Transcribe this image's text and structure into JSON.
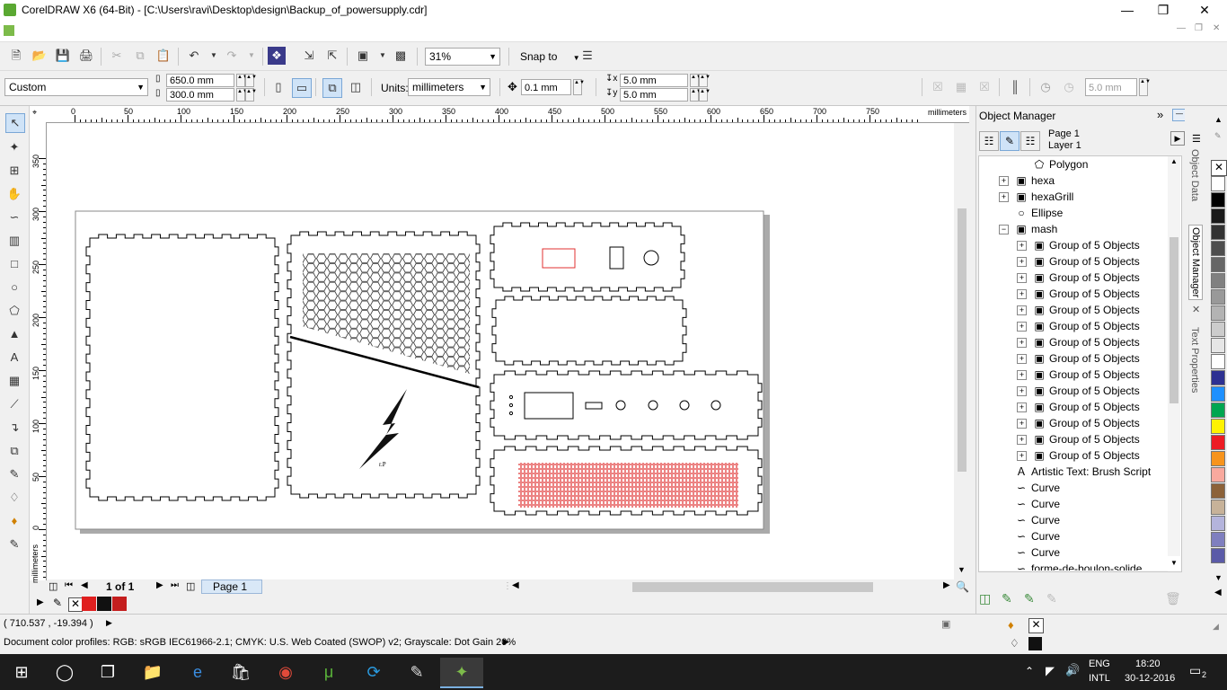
{
  "window": {
    "title": "CorelDRAW X6 (64-Bit) - [C:\\Users\\ravi\\Desktop\\design\\Backup_of_powersupply.cdr]"
  },
  "toolbar": {
    "zoom": "31%",
    "snap_to": "Snap to"
  },
  "property_bar": {
    "preset": "Custom",
    "width": "650.0 mm",
    "height": "300.0 mm",
    "units_label": "Units:",
    "units": "millimeters",
    "nudge": "0.1 mm",
    "dup_x": "5.0 mm",
    "dup_y": "5.0 mm",
    "bleed": "5.0 mm"
  },
  "ruler": {
    "h_ticks": [
      "0",
      "50",
      "100",
      "150",
      "200",
      "250",
      "300",
      "350",
      "400",
      "450",
      "500",
      "550",
      "600",
      "650",
      "700",
      "750"
    ],
    "v_ticks": [
      "350",
      "300",
      "250",
      "200",
      "150",
      "100",
      "50",
      "0"
    ],
    "unit": "millimeters"
  },
  "page_nav": {
    "counter": "1 of 1",
    "tab": "Page 1"
  },
  "docker": {
    "title": "Object Manager",
    "page": "Page 1",
    "layer": "Layer 1",
    "items": [
      {
        "label": "Polygon",
        "icon": "polygon-icon",
        "level": 2,
        "expand": ""
      },
      {
        "label": "hexa",
        "icon": "group-icon",
        "level": 1,
        "expand": "+"
      },
      {
        "label": "hexaGrill",
        "icon": "group-icon",
        "level": 1,
        "expand": "+"
      },
      {
        "label": "Ellipse",
        "icon": "ellipse-icon",
        "level": 1,
        "expand": ""
      },
      {
        "label": "mash",
        "icon": "group-icon",
        "level": 1,
        "expand": "−"
      },
      {
        "label": "Group of 5 Objects",
        "icon": "group-icon",
        "level": 2,
        "expand": "+"
      },
      {
        "label": "Group of 5 Objects",
        "icon": "group-icon",
        "level": 2,
        "expand": "+"
      },
      {
        "label": "Group of 5 Objects",
        "icon": "group-icon",
        "level": 2,
        "expand": "+"
      },
      {
        "label": "Group of 5 Objects",
        "icon": "group-icon",
        "level": 2,
        "expand": "+"
      },
      {
        "label": "Group of 5 Objects",
        "icon": "group-icon",
        "level": 2,
        "expand": "+"
      },
      {
        "label": "Group of 5 Objects",
        "icon": "group-icon",
        "level": 2,
        "expand": "+"
      },
      {
        "label": "Group of 5 Objects",
        "icon": "group-icon",
        "level": 2,
        "expand": "+"
      },
      {
        "label": "Group of 5 Objects",
        "icon": "group-icon",
        "level": 2,
        "expand": "+"
      },
      {
        "label": "Group of 5 Objects",
        "icon": "group-icon",
        "level": 2,
        "expand": "+"
      },
      {
        "label": "Group of 5 Objects",
        "icon": "group-icon",
        "level": 2,
        "expand": "+"
      },
      {
        "label": "Group of 5 Objects",
        "icon": "group-icon",
        "level": 2,
        "expand": "+"
      },
      {
        "label": "Group of 5 Objects",
        "icon": "group-icon",
        "level": 2,
        "expand": "+"
      },
      {
        "label": "Group of 5 Objects",
        "icon": "group-icon",
        "level": 2,
        "expand": "+"
      },
      {
        "label": "Group of 5 Objects",
        "icon": "group-icon",
        "level": 2,
        "expand": "+"
      },
      {
        "label": "Artistic Text: Brush Script",
        "icon": "text-icon",
        "level": 1,
        "expand": ""
      },
      {
        "label": "Curve",
        "icon": "curve-icon",
        "level": 1,
        "expand": ""
      },
      {
        "label": "Curve",
        "icon": "curve-icon",
        "level": 1,
        "expand": ""
      },
      {
        "label": "Curve",
        "icon": "curve-icon",
        "level": 1,
        "expand": ""
      },
      {
        "label": "Curve",
        "icon": "curve-icon",
        "level": 1,
        "expand": ""
      },
      {
        "label": "Curve",
        "icon": "curve-icon",
        "level": 1,
        "expand": ""
      },
      {
        "label": "forme-de-boulon-solide",
        "icon": "curve-icon",
        "level": 1,
        "expand": ""
      }
    ]
  },
  "side_tabs": {
    "object_data": "Object Data",
    "object_manager": "Object Manager",
    "text_properties": "Text Properties"
  },
  "palette": [
    "#ffffff",
    "#000000",
    "#1a1a1a",
    "#333333",
    "#4d4d4d",
    "#666666",
    "#808080",
    "#999999",
    "#b3b3b3",
    "#cccccc",
    "#e6e6e6",
    "#ffffff",
    "#2e3192",
    "#1e90ff",
    "#00a651",
    "#fff200",
    "#ed1c24",
    "#f7941d",
    "#f9a99e",
    "#8c6239",
    "#c7b299",
    "#b4b4dc",
    "#7f7fbf",
    "#5b5ba8"
  ],
  "status": {
    "coords": "( 710.537 , -19.394 )",
    "color_profiles": "Document color profiles: RGB: sRGB IEC61966-2.1; CMYK: U.S. Web Coated (SWOP) v2; Grayscale: Dot Gain 20%"
  },
  "taskbar": {
    "lang1": "ENG",
    "lang2": "INTL",
    "time": "18:20",
    "date": "30-12-2016",
    "notif_count": "2"
  },
  "colors": {
    "accent_red": "#e03030",
    "hex_color": "#333333"
  }
}
